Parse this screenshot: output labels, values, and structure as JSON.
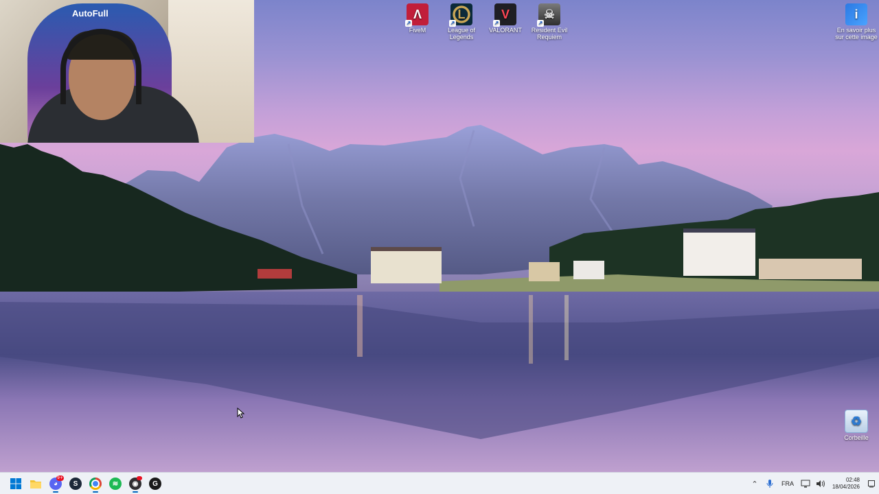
{
  "desktop": {
    "icons": [
      {
        "label": "FiveM",
        "glyph": "Λ",
        "icon": "fivem-icon"
      },
      {
        "label": "League of Legends",
        "glyph": "L",
        "icon": "league-of-legends-icon"
      },
      {
        "label": "VALORANT",
        "glyph": "V",
        "icon": "valorant-icon"
      },
      {
        "label": "Resident Evil Requiem",
        "glyph": "☠",
        "icon": "resident-evil-icon"
      }
    ],
    "spotlight": {
      "label": "En savoir plus sur cette image",
      "glyph": "i"
    },
    "recycle_bin": {
      "label": "Corbeille",
      "glyph": "♻"
    }
  },
  "webcam": {
    "chair_logo": "AutoFull"
  },
  "taskbar": {
    "apps": [
      {
        "name": "start-button",
        "glyph": "⊞",
        "color": "#0078d4"
      },
      {
        "name": "file-explorer",
        "glyph": "▬",
        "color": "#f2c335"
      },
      {
        "name": "discord",
        "glyph": "◕",
        "color": "#5865f2",
        "badge": "9+"
      },
      {
        "name": "steam",
        "glyph": "S",
        "color": "#1b2838"
      },
      {
        "name": "chrome",
        "glyph": "●",
        "color": "#db4437"
      },
      {
        "name": "spotify",
        "glyph": "≋",
        "color": "#1db954"
      },
      {
        "name": "obs",
        "glyph": "◉",
        "color": "#302e31"
      },
      {
        "name": "app-g",
        "glyph": "G",
        "color": "#1a1a1a"
      }
    ],
    "tray": {
      "language": "FRA",
      "time": "02:48",
      "date": "18/04/2026"
    }
  }
}
